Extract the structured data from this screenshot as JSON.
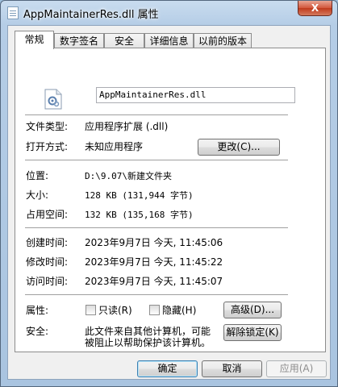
{
  "window": {
    "title": "AppMaintainerRes.dll 属性",
    "close_glyph": "X"
  },
  "tabs": [
    {
      "label": "常规"
    },
    {
      "label": "数字签名"
    },
    {
      "label": "安全"
    },
    {
      "label": "详细信息"
    },
    {
      "label": "以前的版本"
    }
  ],
  "general": {
    "file_name": "AppMaintainerRes.dll",
    "file_type_label": "文件类型:",
    "file_type_value": "应用程序扩展 (.dll)",
    "open_with_label": "打开方式:",
    "open_with_value": "未知应用程序",
    "change_button": "更改(C)...",
    "location_label": "位置:",
    "location_value": "D:\\9.07\\新建文件夹",
    "size_label": "大小:",
    "size_value": "128 KB (131,944 字节)",
    "size_on_disk_label": "占用空间:",
    "size_on_disk_value": "132 KB (135,168 字节)",
    "created_label": "创建时间:",
    "created_value": "2023年9月7日 今天, 11:45:06",
    "modified_label": "修改时间:",
    "modified_value": "2023年9月7日 今天, 11:45:22",
    "accessed_label": "访问时间:",
    "accessed_value": "2023年9月7日 今天, 11:45:07",
    "attributes_label": "属性:",
    "readonly_label": "只读(R)",
    "hidden_label": "隐藏(H)",
    "advanced_button": "高级(D)...",
    "security_label": "安全:",
    "security_text_line1": "此文件来自其他计算机，可能",
    "security_text_line2": "被阻止以帮助保护该计算机。",
    "unblock_button": "解除锁定(K)"
  },
  "footer": {
    "ok": "确定",
    "cancel": "取消",
    "apply": "应用(A)"
  }
}
